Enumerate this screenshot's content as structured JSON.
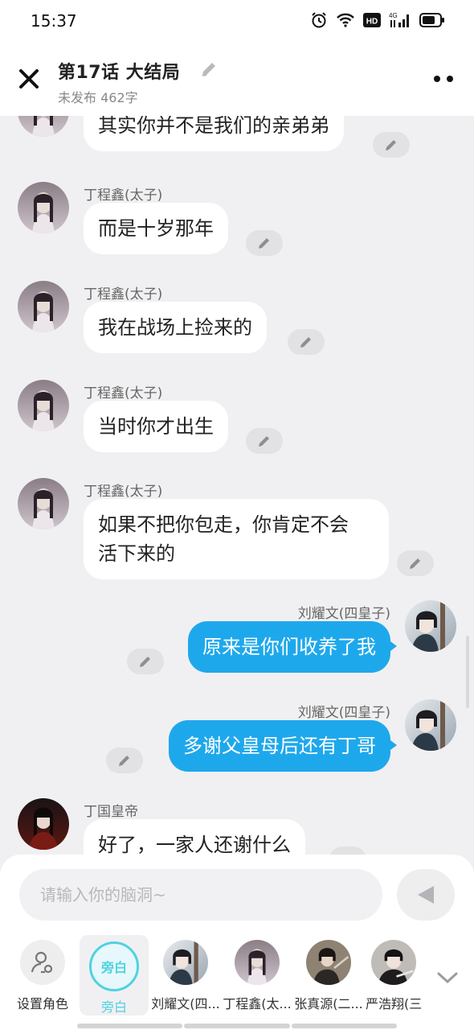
{
  "status": {
    "time": "15:37",
    "network": "4G",
    "hd": "HD"
  },
  "header": {
    "title": "第17话   大结局",
    "subtitle": "未发布 462字"
  },
  "messages": [
    {
      "side": "left",
      "name": "",
      "text": "其实你并不是我们的亲弟弟",
      "avatar": "dingchengxin"
    },
    {
      "side": "left",
      "name": "丁程鑫(太子)",
      "text": "而是十岁那年",
      "avatar": "dingchengxin"
    },
    {
      "side": "left",
      "name": "丁程鑫(太子)",
      "text": "我在战场上捡来的",
      "avatar": "dingchengxin"
    },
    {
      "side": "left",
      "name": "丁程鑫(太子)",
      "text": "当时你才出生",
      "avatar": "dingchengxin"
    },
    {
      "side": "left",
      "name": "丁程鑫(太子)",
      "text_lines": [
        "如果不把你包走，你肯定不会",
        "活下来的"
      ],
      "avatar": "dingchengxin"
    },
    {
      "side": "right",
      "name": "刘耀文(四皇子)",
      "text": "原来是你们收养了我",
      "avatar": "liuyaowen"
    },
    {
      "side": "right",
      "name": "刘耀文(四皇子)",
      "text": "多谢父皇母后还有丁哥",
      "avatar": "liuyaowen"
    },
    {
      "side": "left",
      "name": "丁国皇帝",
      "text": "好了，一家人还谢什么",
      "avatar": "emperor"
    }
  ],
  "input": {
    "placeholder": "请输入你的脑洞~"
  },
  "roles": [
    {
      "label": "设置角色",
      "icon": "person-settings-icon"
    },
    {
      "label": "旁白",
      "badge": "旁白",
      "selected": true
    },
    {
      "label": "刘耀文(四..."
    },
    {
      "label": "丁程鑫(太..."
    },
    {
      "label": "张真源(二..."
    },
    {
      "label": "严浩翔(三"
    }
  ],
  "colors": {
    "accent_blue": "#1ea8ec",
    "narrator_cyan": "#4fd2e0",
    "background": "#f0f0f2"
  }
}
